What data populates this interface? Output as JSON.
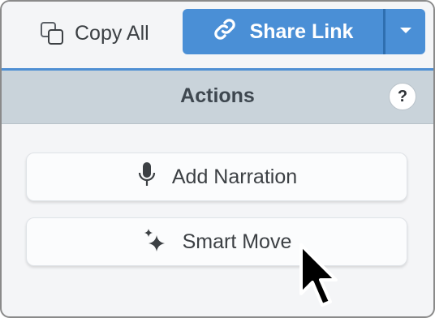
{
  "toolbar": {
    "copy_all_label": "Copy All",
    "copy_all_icon": "copy-icon",
    "share_label": "Share Link",
    "share_icon": "link-icon",
    "dropdown_icon": "caret-down-icon",
    "accent_color": "#4a8fd6"
  },
  "actions": {
    "title": "Actions",
    "help_label": "?",
    "items": [
      {
        "label": "Add Narration",
        "icon": "microphone-icon"
      },
      {
        "label": "Smart Move",
        "icon": "sparkles-icon"
      }
    ]
  }
}
